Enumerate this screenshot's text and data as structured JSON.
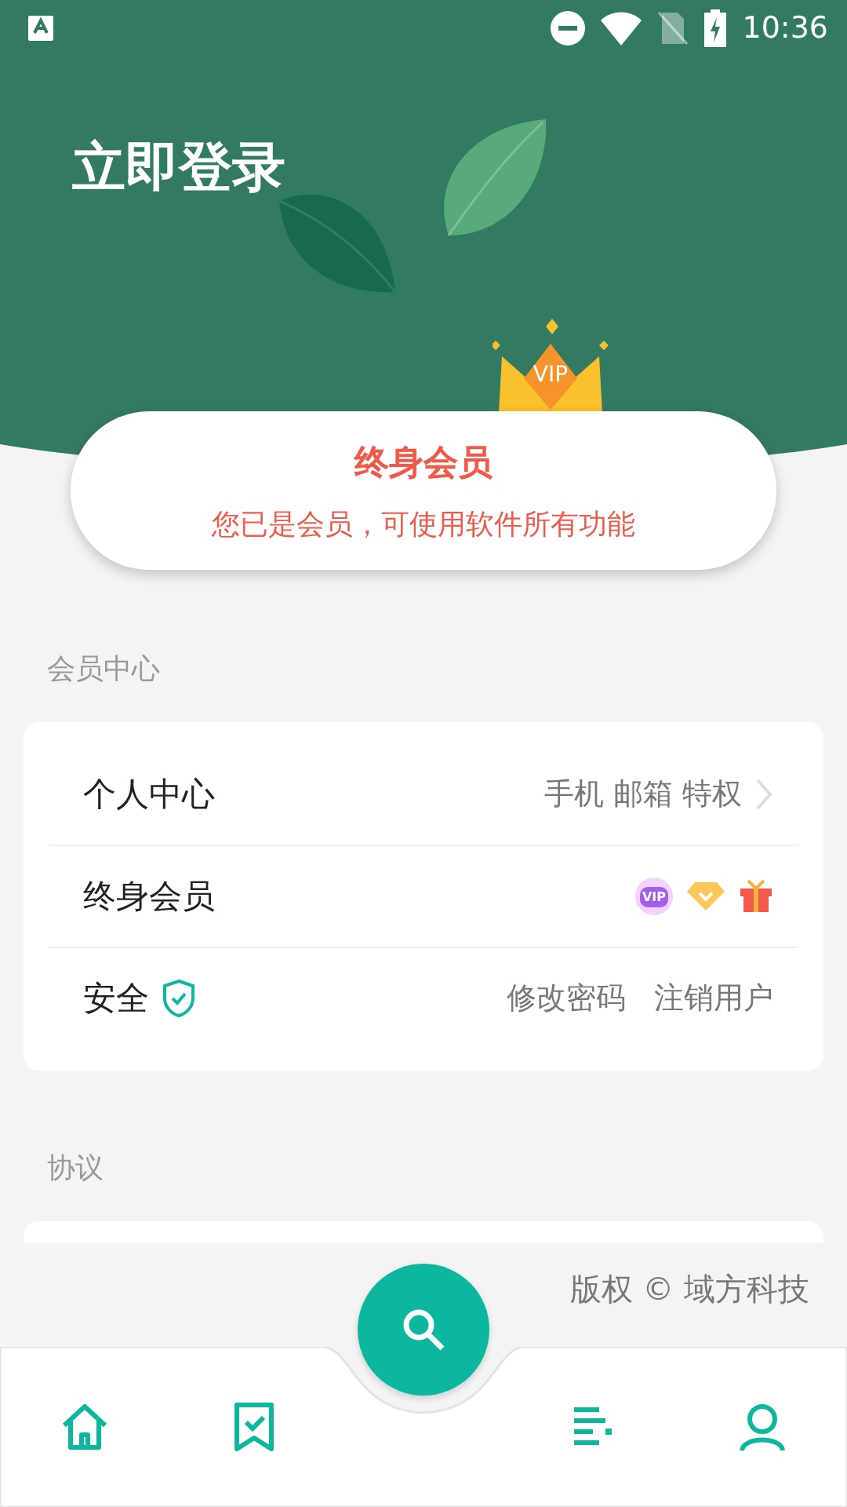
{
  "status_bar": {
    "time": "10:36"
  },
  "header": {
    "title": "立即登录",
    "crown_label": "VIP"
  },
  "member_card": {
    "title": "终身会员",
    "subtitle": "您已是会员，可使用软件所有功能"
  },
  "sections": [
    {
      "label": "会员中心",
      "rows": [
        {
          "kind": "link",
          "label": "个人中心",
          "detail": "手机 邮箱 特权"
        },
        {
          "kind": "badges",
          "label": "终身会员",
          "badge_text": "VIP"
        },
        {
          "kind": "security",
          "label": "安全",
          "actions": [
            "修改密码",
            "注销用户"
          ]
        }
      ]
    },
    {
      "label": "协议"
    }
  ],
  "copyright": "版权 © 域方科技",
  "nav": [
    {
      "kind": "home"
    },
    {
      "kind": "bookmark"
    },
    {
      "kind": "search"
    },
    {
      "kind": "list"
    },
    {
      "kind": "person"
    }
  ]
}
